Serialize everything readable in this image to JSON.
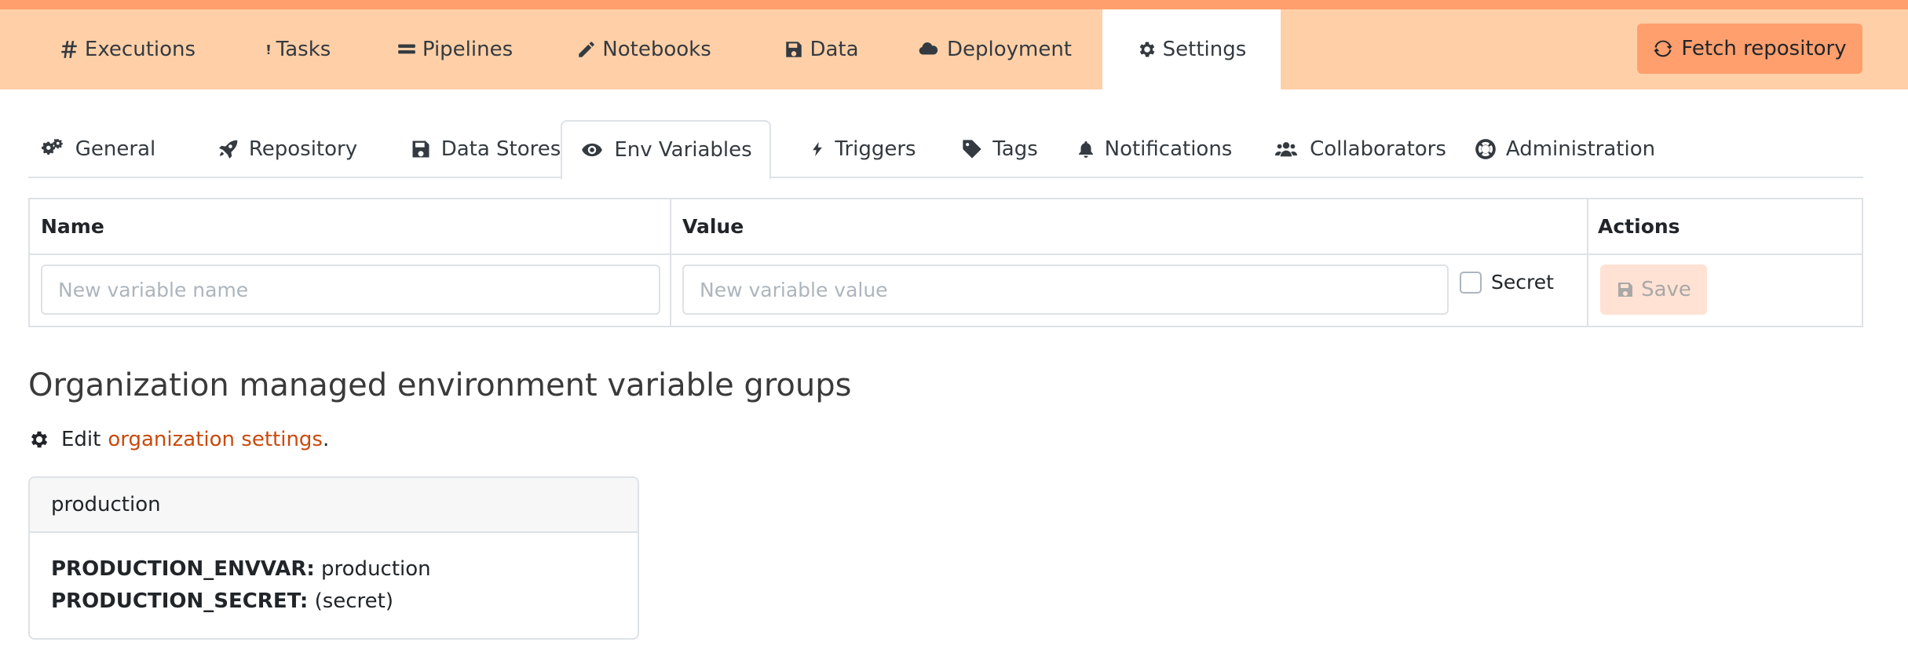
{
  "topnav": {
    "items": [
      {
        "label": "Executions",
        "icon": "hash-icon"
      },
      {
        "label": "Tasks",
        "icon": "exclamation-icon"
      },
      {
        "label": "Pipelines",
        "icon": "equals-icon"
      },
      {
        "label": "Notebooks",
        "icon": "pencil-icon"
      },
      {
        "label": "Data",
        "icon": "save-icon"
      },
      {
        "label": "Deployment",
        "icon": "cloud-icon"
      },
      {
        "label": "Settings",
        "icon": "cog-icon",
        "active": true
      }
    ],
    "fetch_label": "Fetch repository"
  },
  "subtabs": {
    "items": [
      {
        "label": "General",
        "icon": "cogs-icon"
      },
      {
        "label": "Repository",
        "icon": "rocket-icon"
      },
      {
        "label": "Data Stores",
        "icon": "save-icon"
      },
      {
        "label": "Env Variables",
        "icon": "eye-icon",
        "active": true
      },
      {
        "label": "Triggers",
        "icon": "bolt-icon"
      },
      {
        "label": "Tags",
        "icon": "tag-icon"
      },
      {
        "label": "Notifications",
        "icon": "bell-icon"
      },
      {
        "label": "Collaborators",
        "icon": "users-icon"
      },
      {
        "label": "Administration",
        "icon": "life-ring-icon"
      }
    ]
  },
  "env_table": {
    "headers": {
      "name": "Name",
      "value": "Value",
      "actions": "Actions"
    },
    "name_placeholder": "New variable name",
    "value_placeholder": "New variable value",
    "secret_label": "Secret",
    "secret_checked": false,
    "save_label": "Save"
  },
  "org_groups": {
    "title": "Organization managed environment variable groups",
    "edit_prefix": "Edit",
    "edit_link": "organization settings",
    "edit_suffix": ".",
    "groups": [
      {
        "name": "production",
        "vars": [
          {
            "key": "PRODUCTION_ENVVAR:",
            "value": "production"
          },
          {
            "key": "PRODUCTION_SECRET:",
            "value": "(secret)"
          }
        ]
      }
    ]
  },
  "colors": {
    "accent_bar": "#ff9f6e",
    "nav_bg": "#ffd0a8",
    "link": "#c94a0c",
    "save_disabled_bg": "#ffe2d3"
  }
}
